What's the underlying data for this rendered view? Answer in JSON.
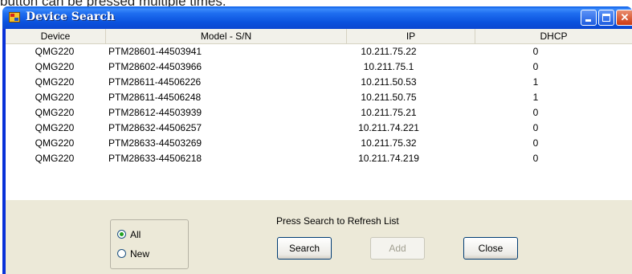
{
  "top_text": "button can be pressed multiple times.",
  "window": {
    "title": "Device Search"
  },
  "table": {
    "columns": [
      "Device",
      "Model - S/N",
      "IP",
      "DHCP"
    ],
    "rows": [
      [
        "QMG220",
        "PTM28601-44503941",
        "10.211.75.22",
        "0"
      ],
      [
        "QMG220",
        "PTM28602-44503966",
        "10.211.75.1",
        "0"
      ],
      [
        "QMG220",
        "PTM28611-44506226",
        "10.211.50.53",
        "1"
      ],
      [
        "QMG220",
        "PTM28611-44506248",
        "10.211.50.75",
        "1"
      ],
      [
        "QMG220",
        "PTM28612-44503939",
        "10.211.75.21",
        "0"
      ],
      [
        "QMG220",
        "PTM28632-44506257",
        "10.211.74.221",
        "0"
      ],
      [
        "QMG220",
        "PTM28633-44503269",
        "10.211.75.32",
        "0"
      ],
      [
        "QMG220",
        "PTM28633-44506218",
        "10.211.74.219",
        "0"
      ]
    ]
  },
  "filter": {
    "all_label": "All",
    "new_label": "New",
    "selected": "All"
  },
  "hint": "Press Search to Refresh List",
  "buttons": {
    "search": "Search",
    "add": "Add",
    "close": "Close"
  },
  "colors": {
    "titlebar": "#0a52de",
    "client_bg": "#ece9d8",
    "close_btn": "#cc3a12",
    "radio_dot": "#21a121"
  },
  "icons": {
    "app": "device-search-app-icon",
    "minimize": "minimize-icon",
    "maximize": "maximize-icon",
    "close": "close-icon"
  }
}
